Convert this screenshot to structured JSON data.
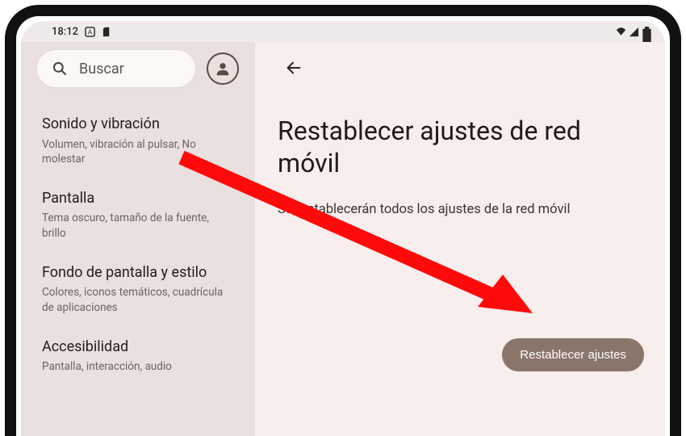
{
  "statusbar": {
    "time": "18:12"
  },
  "sidebar": {
    "search_placeholder": "Buscar",
    "items": [
      {
        "title": "Sonido y vibración",
        "subtitle": "Volumen, vibración al pulsar, No molestar"
      },
      {
        "title": "Pantalla",
        "subtitle": "Tema oscuro, tamaño de la fuente, brillo"
      },
      {
        "title": "Fondo de pantalla y estilo",
        "subtitle": "Colores, iconos temáticos, cuadrícula de aplicaciones"
      },
      {
        "title": "Accesibilidad",
        "subtitle": "Pantalla, interacción, audio"
      }
    ]
  },
  "main": {
    "title": "Restablecer ajustes de red móvil",
    "description": "Se restablecerán todos los ajustes de la red móvil",
    "action_label": "Restablecer ajustes"
  },
  "colors": {
    "accent_button": "#8a756b",
    "arrow": "#ff0a0a"
  }
}
